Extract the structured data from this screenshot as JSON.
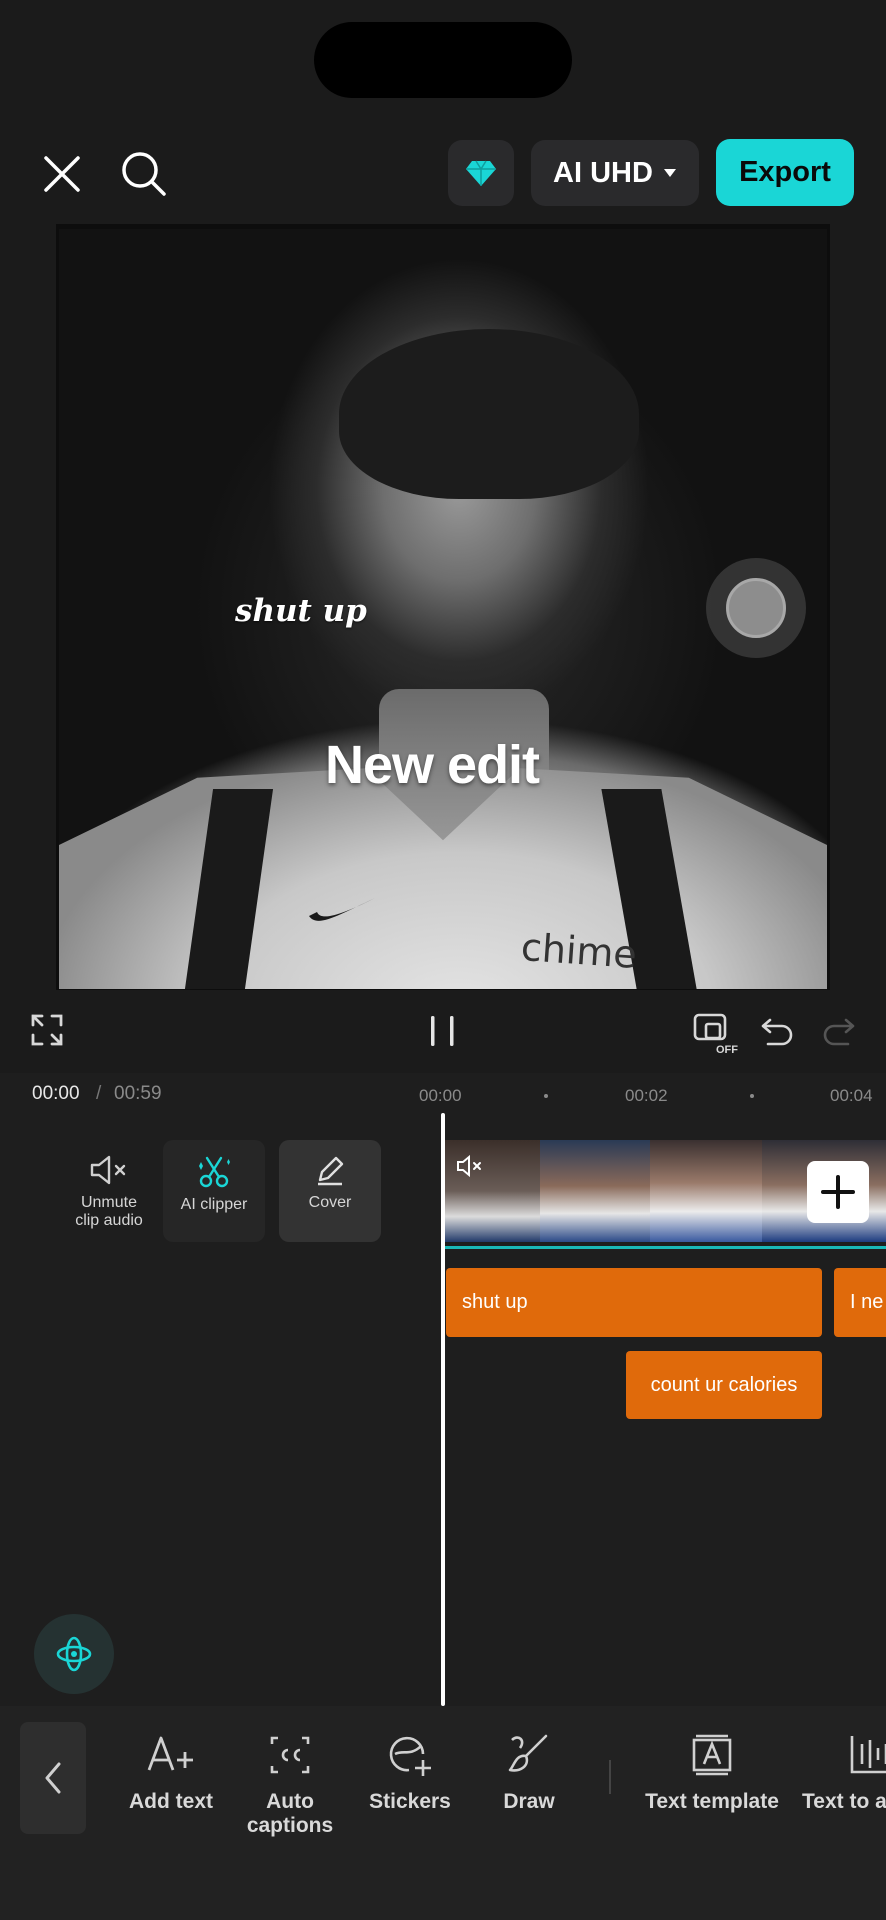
{
  "top_bar": {
    "close_icon": "close-icon",
    "search_icon": "search-icon",
    "gem_icon": "diamond-icon",
    "quality_label": "AI UHD",
    "export_label": "Export",
    "accent": "#1ad6d6"
  },
  "preview": {
    "caption_top": "shut up",
    "caption_center": "New edit",
    "jersey_text": "chime"
  },
  "playback": {
    "pip_badge": "OFF"
  },
  "timeline": {
    "current_time": "00:00",
    "separator": "/",
    "total_time": "00:59",
    "ruler": [
      "00:00",
      "00:02",
      "00:04"
    ],
    "side_tools": [
      {
        "label_line1": "Unmute",
        "label_line2": "clip audio"
      },
      {
        "label": "AI clipper"
      },
      {
        "label": "Cover"
      }
    ],
    "text_clips": [
      "shut up",
      "I ne",
      "count ur calories"
    ],
    "clip_color": "#e06a0b"
  },
  "toolbar": {
    "items": [
      {
        "label": "Add text"
      },
      {
        "label_line1": "Auto",
        "label_line2": "captions"
      },
      {
        "label": "Stickers"
      },
      {
        "label": "Draw"
      },
      {
        "label": "Text template"
      },
      {
        "label": "Text to a"
      }
    ]
  }
}
